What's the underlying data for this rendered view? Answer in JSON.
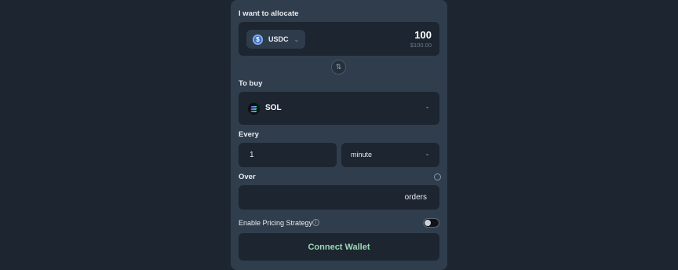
{
  "allocate": {
    "label": "I want to allocate",
    "token": "USDC",
    "token_icon": "usdc-coin-icon",
    "amount": "100",
    "amount_usd": "$100.00"
  },
  "swap_icon": "swap-vertical-icon",
  "buy": {
    "label": "To buy",
    "token": "SOL",
    "token_icon": "sol-coin-icon"
  },
  "every": {
    "label": "Every",
    "value": "1",
    "unit": "minute"
  },
  "over": {
    "label": "Over",
    "value": "",
    "suffix": "orders"
  },
  "pricing_strategy": {
    "label": "Enable Pricing Strategy",
    "enabled": false
  },
  "connect_button": "Connect Wallet",
  "colors": {
    "background": "#1c2530",
    "panel": "#303d4d",
    "input": "#1c2530",
    "connect_text": "#9fd9b7"
  }
}
